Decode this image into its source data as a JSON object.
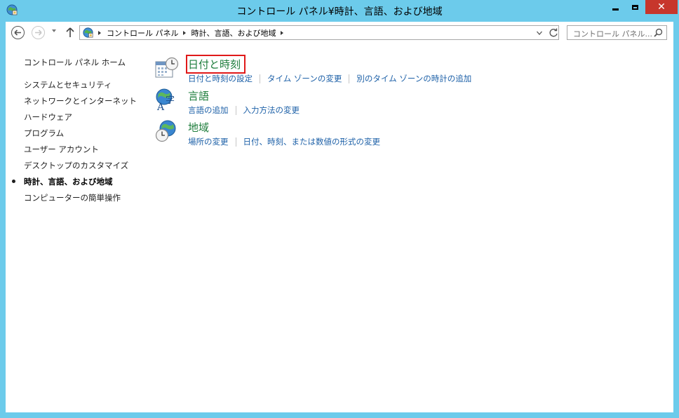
{
  "window": {
    "title": "コントロール パネル¥時計、言語、および地域",
    "close_glyph": "✕"
  },
  "address_bar": {
    "breadcrumbs": [
      "コントロール パネル",
      "時計、言語、および地域"
    ]
  },
  "search": {
    "placeholder": "コントロール パネル..."
  },
  "sidebar": {
    "items": [
      {
        "label": "コントロール パネル ホーム"
      },
      {
        "label": "システムとセキュリティ"
      },
      {
        "label": "ネットワークとインターネット"
      },
      {
        "label": "ハードウェア"
      },
      {
        "label": "プログラム"
      },
      {
        "label": "ユーザー アカウント"
      },
      {
        "label": "デスクトップのカスタマイズ"
      },
      {
        "label": "時計、言語、および地域",
        "current": true
      },
      {
        "label": "コンピューターの簡単操作"
      }
    ]
  },
  "categories": [
    {
      "title": "日付と時刻",
      "icon": "calendar-clock-icon",
      "highlighted": true,
      "links": [
        "日付と時刻の設定",
        "タイム ゾーンの変更",
        "別のタイム ゾーンの時計の追加"
      ]
    },
    {
      "title": "言語",
      "icon": "language-globe-icon",
      "links": [
        "言語の追加",
        "入力方法の変更"
      ]
    },
    {
      "title": "地域",
      "icon": "region-globe-clock-icon",
      "links": [
        "場所の変更",
        "日付、時刻、または数値の形式の変更"
      ]
    }
  ],
  "colors": {
    "frame": "#6ccbeb",
    "close_button": "#c7362c",
    "category_title": "#1e7d3c",
    "link": "#1e61a8",
    "highlight_box": "#e01919"
  }
}
